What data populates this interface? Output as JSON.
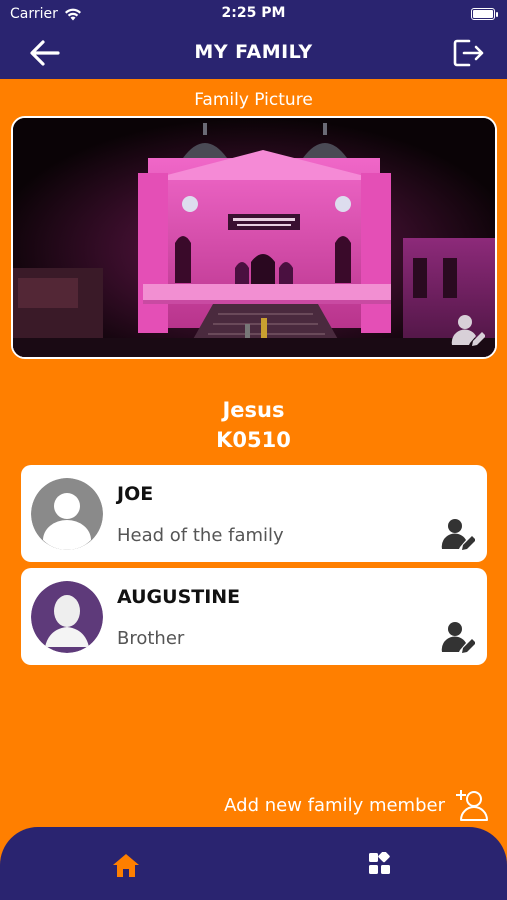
{
  "status_bar": {
    "carrier": "Carrier",
    "time": "2:25 PM"
  },
  "header": {
    "title": "MY FAMILY",
    "back_icon": "arrow-left-icon",
    "logout_icon": "logout-icon"
  },
  "family_picture": {
    "label": "Family Picture",
    "edit_icon": "user-edit-icon"
  },
  "family": {
    "name": "Jesus",
    "code": "K0510"
  },
  "members": [
    {
      "name": "JOE",
      "relation": "Head of the family",
      "edit_icon": "user-edit-icon"
    },
    {
      "name": "AUGUSTINE",
      "relation": "Brother",
      "edit_icon": "user-edit-icon"
    }
  ],
  "add_member": {
    "label": "Add new family member",
    "icon": "user-add-icon"
  },
  "bottom_nav": {
    "home_icon": "home-icon",
    "grid_icon": "grid-icon",
    "active": "home"
  },
  "colors": {
    "header_bg": "#2A2470",
    "page_bg": "#FF7F00",
    "accent": "#FF7F00",
    "card_bg": "#FFFFFF"
  }
}
